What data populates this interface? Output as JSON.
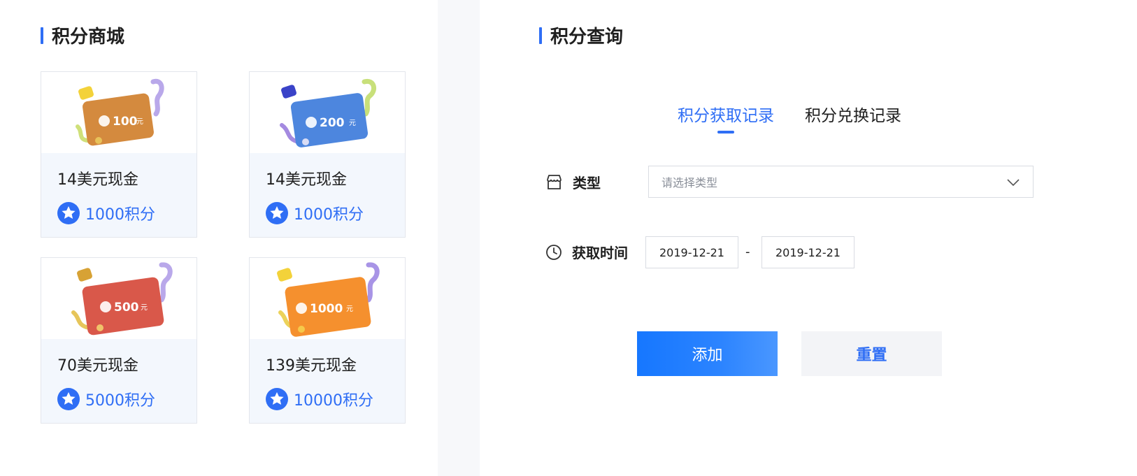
{
  "mall": {
    "title": "积分商城",
    "cards": [
      {
        "name": "14美元现金",
        "points": "1000积分",
        "amount": "100",
        "unit": "元",
        "color": "#d48a3e"
      },
      {
        "name": "14美元现金",
        "points": "1000积分",
        "amount": "200",
        "unit": "元",
        "color": "#4d86de"
      },
      {
        "name": "70美元现金",
        "points": "5000积分",
        "amount": "500",
        "unit": "元",
        "color": "#d9584a"
      },
      {
        "name": "139美元现金",
        "points": "10000积分",
        "amount": "1000",
        "unit": "元",
        "color": "#f5902e"
      }
    ]
  },
  "query": {
    "title": "积分查询",
    "tabs": [
      {
        "label": "积分获取记录",
        "active": true
      },
      {
        "label": "积分兑换记录",
        "active": false
      }
    ],
    "type_label": "类型",
    "type_placeholder": "请选择类型",
    "time_label": "获取时间",
    "date_start": "2019-12-21",
    "date_separator": "-",
    "date_end": "2019-12-21",
    "add_label": "添加",
    "reset_label": "重置"
  },
  "colors": {
    "accent": "#2f6ef5",
    "primary_button": "#1677ff"
  }
}
